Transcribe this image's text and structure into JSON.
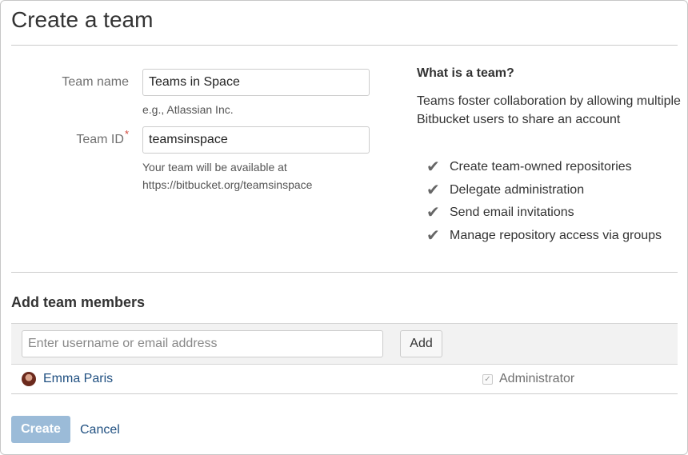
{
  "page": {
    "title": "Create a team"
  },
  "form": {
    "team_name_label": "Team name",
    "team_name_value": "Teams in Space",
    "team_name_hint": "e.g., Atlassian Inc.",
    "team_id_label": "Team ID",
    "required_marker": "*",
    "team_id_value": "teamsinspace",
    "team_id_hint": "Your team will be available at https://bitbucket.org/teamsinspace"
  },
  "aside": {
    "title": "What is a team?",
    "description": "Teams foster collaboration by allowing multiple Bitbucket users to share an account",
    "check_glyph": "✔",
    "features": [
      "Create team-owned repositories",
      "Delegate administration",
      "Send email invitations",
      "Manage repository access via groups"
    ]
  },
  "members": {
    "section_title": "Add team members",
    "input_placeholder": "Enter username or email address",
    "add_label": "Add",
    "list": [
      {
        "name": "Emma Paris",
        "role_label": "Administrator",
        "admin_checked": true
      }
    ],
    "check_glyph": "✓"
  },
  "actions": {
    "create_label": "Create",
    "cancel_label": "Cancel"
  },
  "colors": {
    "link": "#205081",
    "create_disabled": "#9bbbd8",
    "required": "#d04437"
  },
  "icons": {
    "avatar": "user-avatar",
    "feature_check": "check-icon",
    "admin_checkbox": "checkbox-checked-icon"
  }
}
